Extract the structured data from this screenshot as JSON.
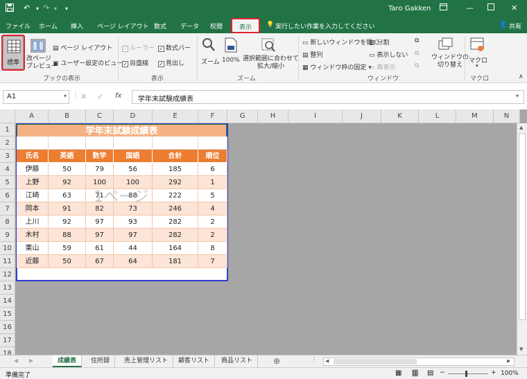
{
  "window": {
    "user": "Taro Gakken",
    "share": "共有"
  },
  "tabs": [
    "ファイル",
    "ホーム",
    "挿入",
    "ページ レイアウト",
    "数式",
    "データ",
    "校閲",
    "表示"
  ],
  "active_tab": "表示",
  "tell_me": "実行したい作業を入力してください",
  "ribbon": {
    "book_view": {
      "label": "ブックの表示",
      "normal": "標準",
      "page_break": "改ページ\nプレビュー",
      "page_layout": "ページ レイアウト",
      "custom_view": "ユーザー設定のビュー"
    },
    "show": {
      "label": "表示",
      "ruler": "ルーラー",
      "formula_bar": "数式バー",
      "gridlines": "目盛線",
      "headings": "見出し"
    },
    "zoom": {
      "label": "ズーム",
      "zoom": "ズーム",
      "zoom100": "100%",
      "zoom_selection": "選択範囲に合わせて\n拡大/縮小"
    },
    "window": {
      "label": "ウィンドウ",
      "new_window": "新しいウィンドウを開く",
      "arrange": "整列",
      "freeze": "ウィンドウ枠の固定",
      "split": "分割",
      "hide": "表示しない",
      "unhide": "再表示",
      "switch": "ウィンドウの\n切り替え"
    },
    "macro": {
      "label": "マクロ",
      "macro": "マクロ"
    }
  },
  "formula_bar": {
    "name_box": "A1",
    "fx": "fx",
    "content": "学年末試験成績表"
  },
  "columns": [
    "A",
    "B",
    "C",
    "D",
    "E",
    "F",
    "G",
    "H",
    "I",
    "J",
    "K",
    "L",
    "M",
    "N"
  ],
  "rows": [
    "1",
    "2",
    "3",
    "4",
    "5",
    "6",
    "7",
    "8",
    "9",
    "10",
    "11",
    "12",
    "13",
    "14",
    "15",
    "16",
    "17",
    "18"
  ],
  "sheet": {
    "title": "学年末試験成績表",
    "headers": [
      "氏名",
      "英語",
      "数学",
      "国語",
      "合計",
      "順位"
    ],
    "data": [
      [
        "伊藤",
        "50",
        "79",
        "56",
        "185",
        "6"
      ],
      [
        "上野",
        "92",
        "100",
        "100",
        "292",
        "1"
      ],
      [
        "江崎",
        "63",
        "71",
        "88",
        "222",
        "5"
      ],
      [
        "岡本",
        "91",
        "82",
        "73",
        "246",
        "4"
      ],
      [
        "上川",
        "92",
        "97",
        "93",
        "282",
        "2"
      ],
      [
        "木村",
        "88",
        "97",
        "97",
        "282",
        "2"
      ],
      [
        "栗山",
        "59",
        "61",
        "44",
        "164",
        "8"
      ],
      [
        "近藤",
        "50",
        "67",
        "64",
        "181",
        "7"
      ]
    ],
    "watermark": "1ページ"
  },
  "sheet_tabs": [
    "成績表",
    "住所録",
    "売上管理リスト",
    "顧客リスト",
    "商品リスト"
  ],
  "active_sheet": "成績表",
  "status": {
    "ready": "準備完了",
    "zoom": "100%"
  },
  "colors": {
    "excel_green": "#217346",
    "header_orange": "#ed7d31",
    "title_orange": "#f4b183",
    "band": "#fce4d6",
    "highlight_red": "#e0232e",
    "page_border": "#2f3cd6"
  }
}
